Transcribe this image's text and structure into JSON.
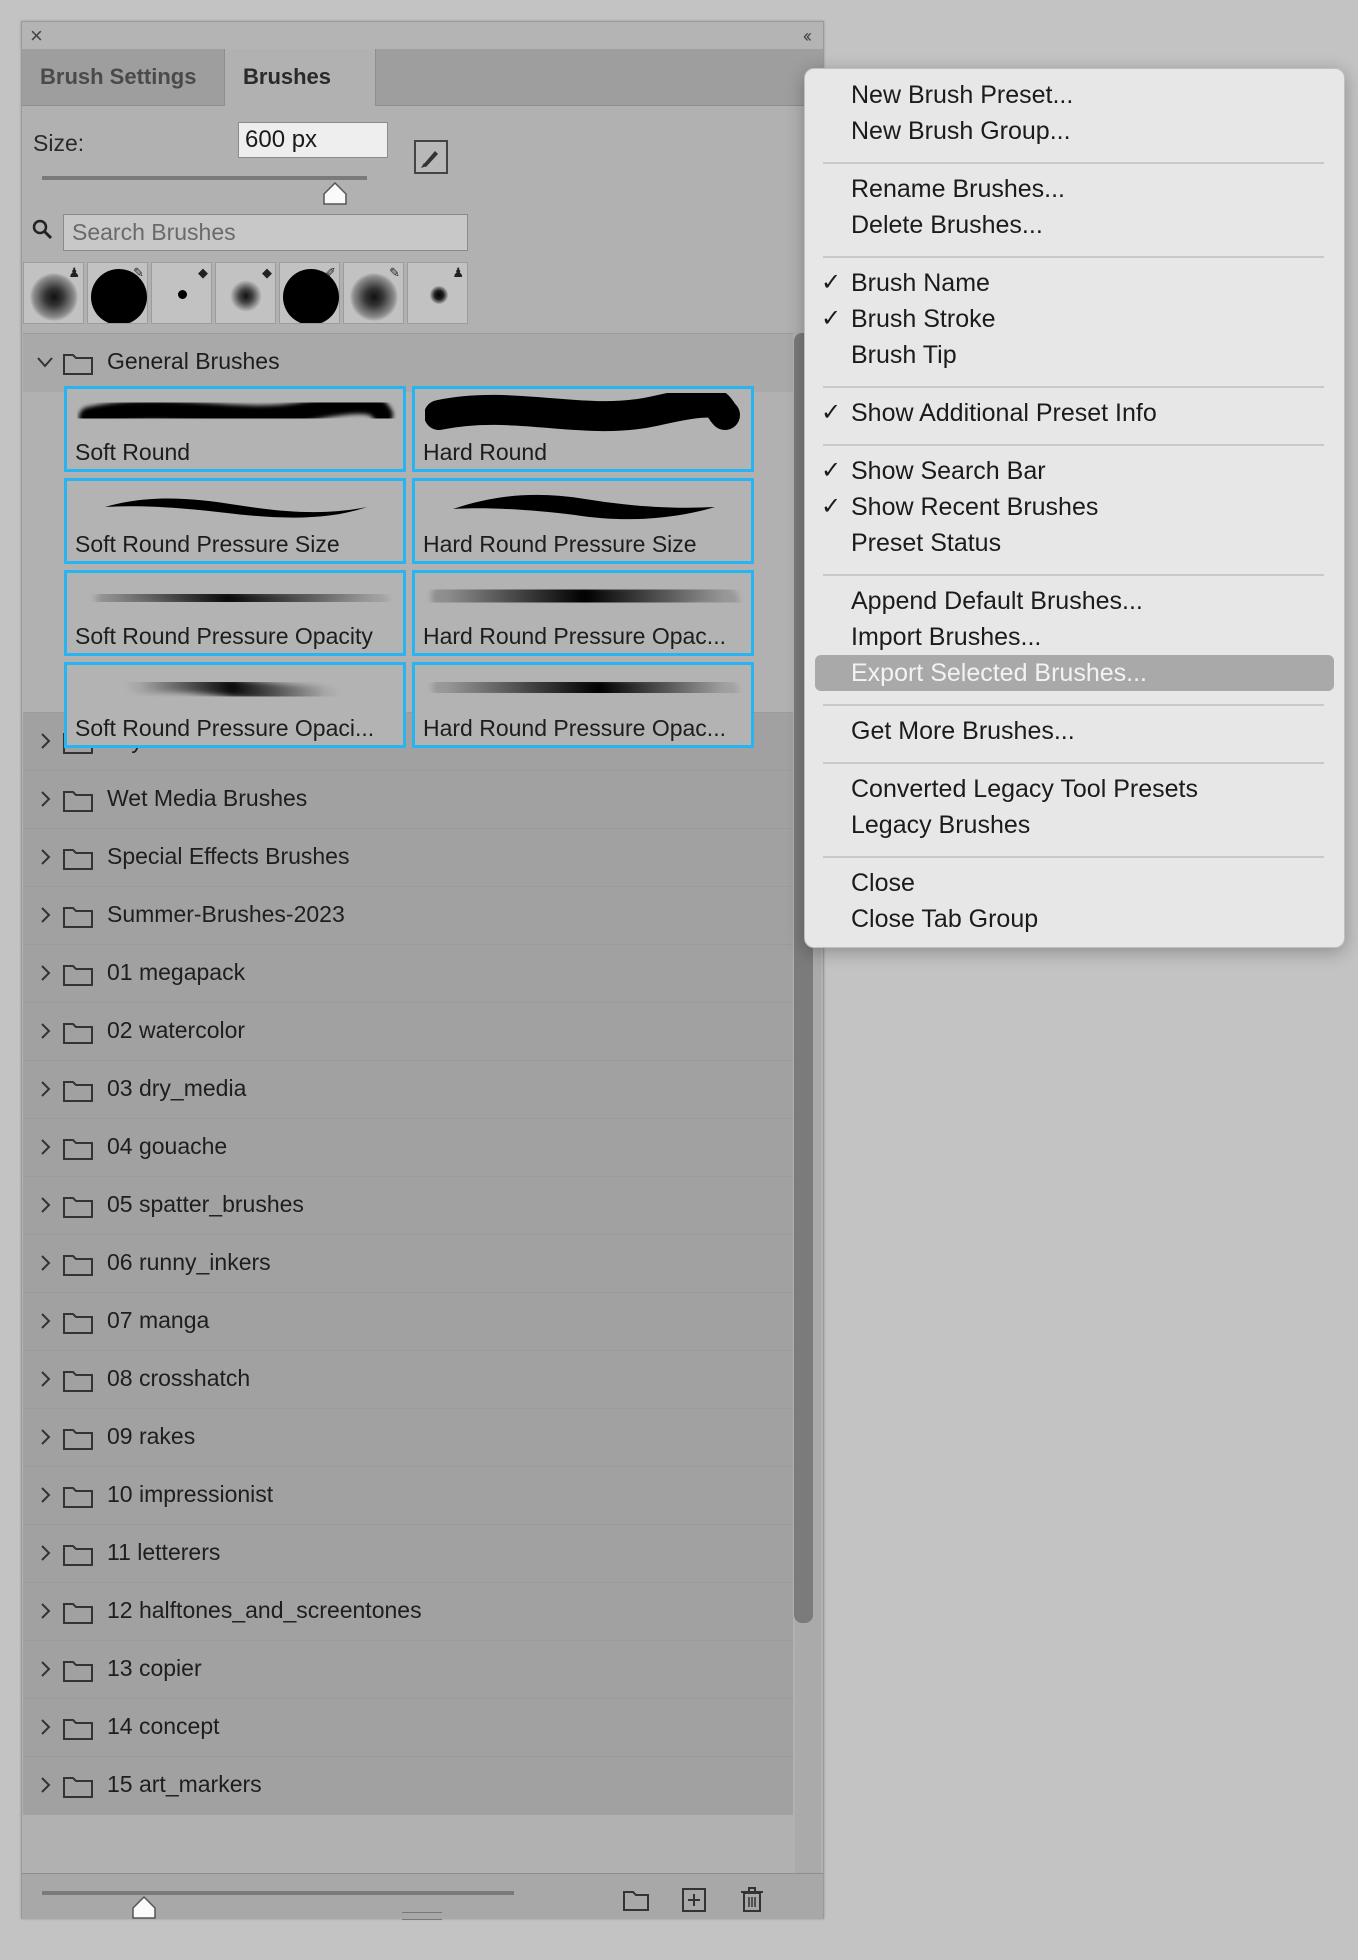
{
  "panel": {
    "tabs": [
      "Brush Settings",
      "Brushes"
    ],
    "active_tab": "Brushes",
    "size_label": "Size:",
    "size_value": "600 px",
    "search_placeholder": "Search Brushes",
    "recent_brushes": [
      {
        "tip": "soft",
        "tool": "stamp-icon"
      },
      {
        "tip": "hard-large",
        "tool": "brush-icon"
      },
      {
        "tip": "dot-small",
        "tool": "eraser-icon"
      },
      {
        "tip": "soft-small",
        "tool": "eraser-icon"
      },
      {
        "tip": "hard-large",
        "tool": "pencil-icon"
      },
      {
        "tip": "soft",
        "tool": "brush-icon"
      },
      {
        "tip": "dot-small-soft",
        "tool": "stamp-icon"
      }
    ],
    "open_group": "General Brushes",
    "general_brushes": [
      "Soft Round",
      "Hard Round",
      "Soft Round Pressure Size",
      "Hard Round Pressure Size",
      "Soft Round Pressure Opacity",
      "Hard Round Pressure Opac...",
      "Soft Round Pressure Opaci...",
      "Hard Round Pressure Opac..."
    ],
    "groups": [
      "Dry Media Brushes",
      "Wet Media Brushes",
      "Special Effects Brushes",
      "Summer-Brushes-2023",
      "01 megapack",
      "02 watercolor",
      "03 dry_media",
      "04 gouache",
      "05 spatter_brushes",
      "06 runny_inkers",
      "07 manga",
      "08 crosshatch",
      "09 rakes",
      "10 impressionist",
      "11 letterers",
      "12 halftones_and_screentones",
      "13 copier",
      "14 concept",
      "15 art_markers"
    ]
  },
  "menu": {
    "items": [
      {
        "label": "New Brush Preset...",
        "checked": false
      },
      {
        "label": "New Brush Group...",
        "checked": false
      },
      {
        "label": "Rename Brushes...",
        "checked": false
      },
      {
        "label": "Delete Brushes...",
        "checked": false
      },
      {
        "label": "Brush Name",
        "checked": true
      },
      {
        "label": "Brush Stroke",
        "checked": true
      },
      {
        "label": "Brush Tip",
        "checked": false
      },
      {
        "label": "Show Additional Preset Info",
        "checked": true
      },
      {
        "label": "Show Search Bar",
        "checked": true
      },
      {
        "label": "Show Recent Brushes",
        "checked": true
      },
      {
        "label": "Preset Status",
        "checked": false
      },
      {
        "label": "Append Default Brushes...",
        "checked": false
      },
      {
        "label": "Import Brushes...",
        "checked": false
      },
      {
        "label": "Export Selected Brushes...",
        "checked": false,
        "highlighted": true
      },
      {
        "label": "Get More Brushes...",
        "checked": false
      },
      {
        "label": "Converted Legacy Tool Presets",
        "checked": false
      },
      {
        "label": "Legacy Brushes",
        "checked": false
      },
      {
        "label": "Close",
        "checked": false
      },
      {
        "label": "Close Tab Group",
        "checked": false
      }
    ],
    "check_glyph": "✓"
  },
  "colors": {
    "selection_border": "#28b4f0",
    "menu_highlight": "#a9a9a9"
  }
}
